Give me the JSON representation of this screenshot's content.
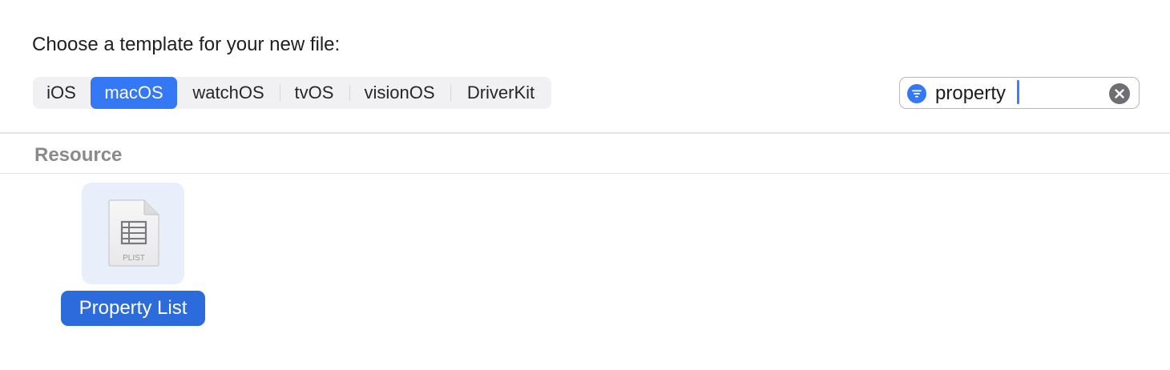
{
  "dialog": {
    "prompt": "Choose a template for your new file:"
  },
  "platform_tabs": {
    "selected": "macOS",
    "items": [
      {
        "label": "iOS",
        "active": false
      },
      {
        "label": "macOS",
        "active": true
      },
      {
        "label": "watchOS",
        "active": false
      },
      {
        "label": "tvOS",
        "active": false
      },
      {
        "label": "visionOS",
        "active": false
      },
      {
        "label": "DriverKit",
        "active": false
      }
    ]
  },
  "search": {
    "value": "property",
    "filter_icon": "line-horizontal-decrease-circle-fill",
    "clear_icon": "xmark-circle-fill"
  },
  "section": {
    "title": "Resource"
  },
  "templates": [
    {
      "label": "Property List",
      "icon": "plist-document-icon",
      "icon_caption": "PLIST",
      "selected": true
    }
  ],
  "colors": {
    "accent": "#3478f6",
    "selection_label": "#2b6bdc",
    "selection_tile": "#e9effa"
  }
}
